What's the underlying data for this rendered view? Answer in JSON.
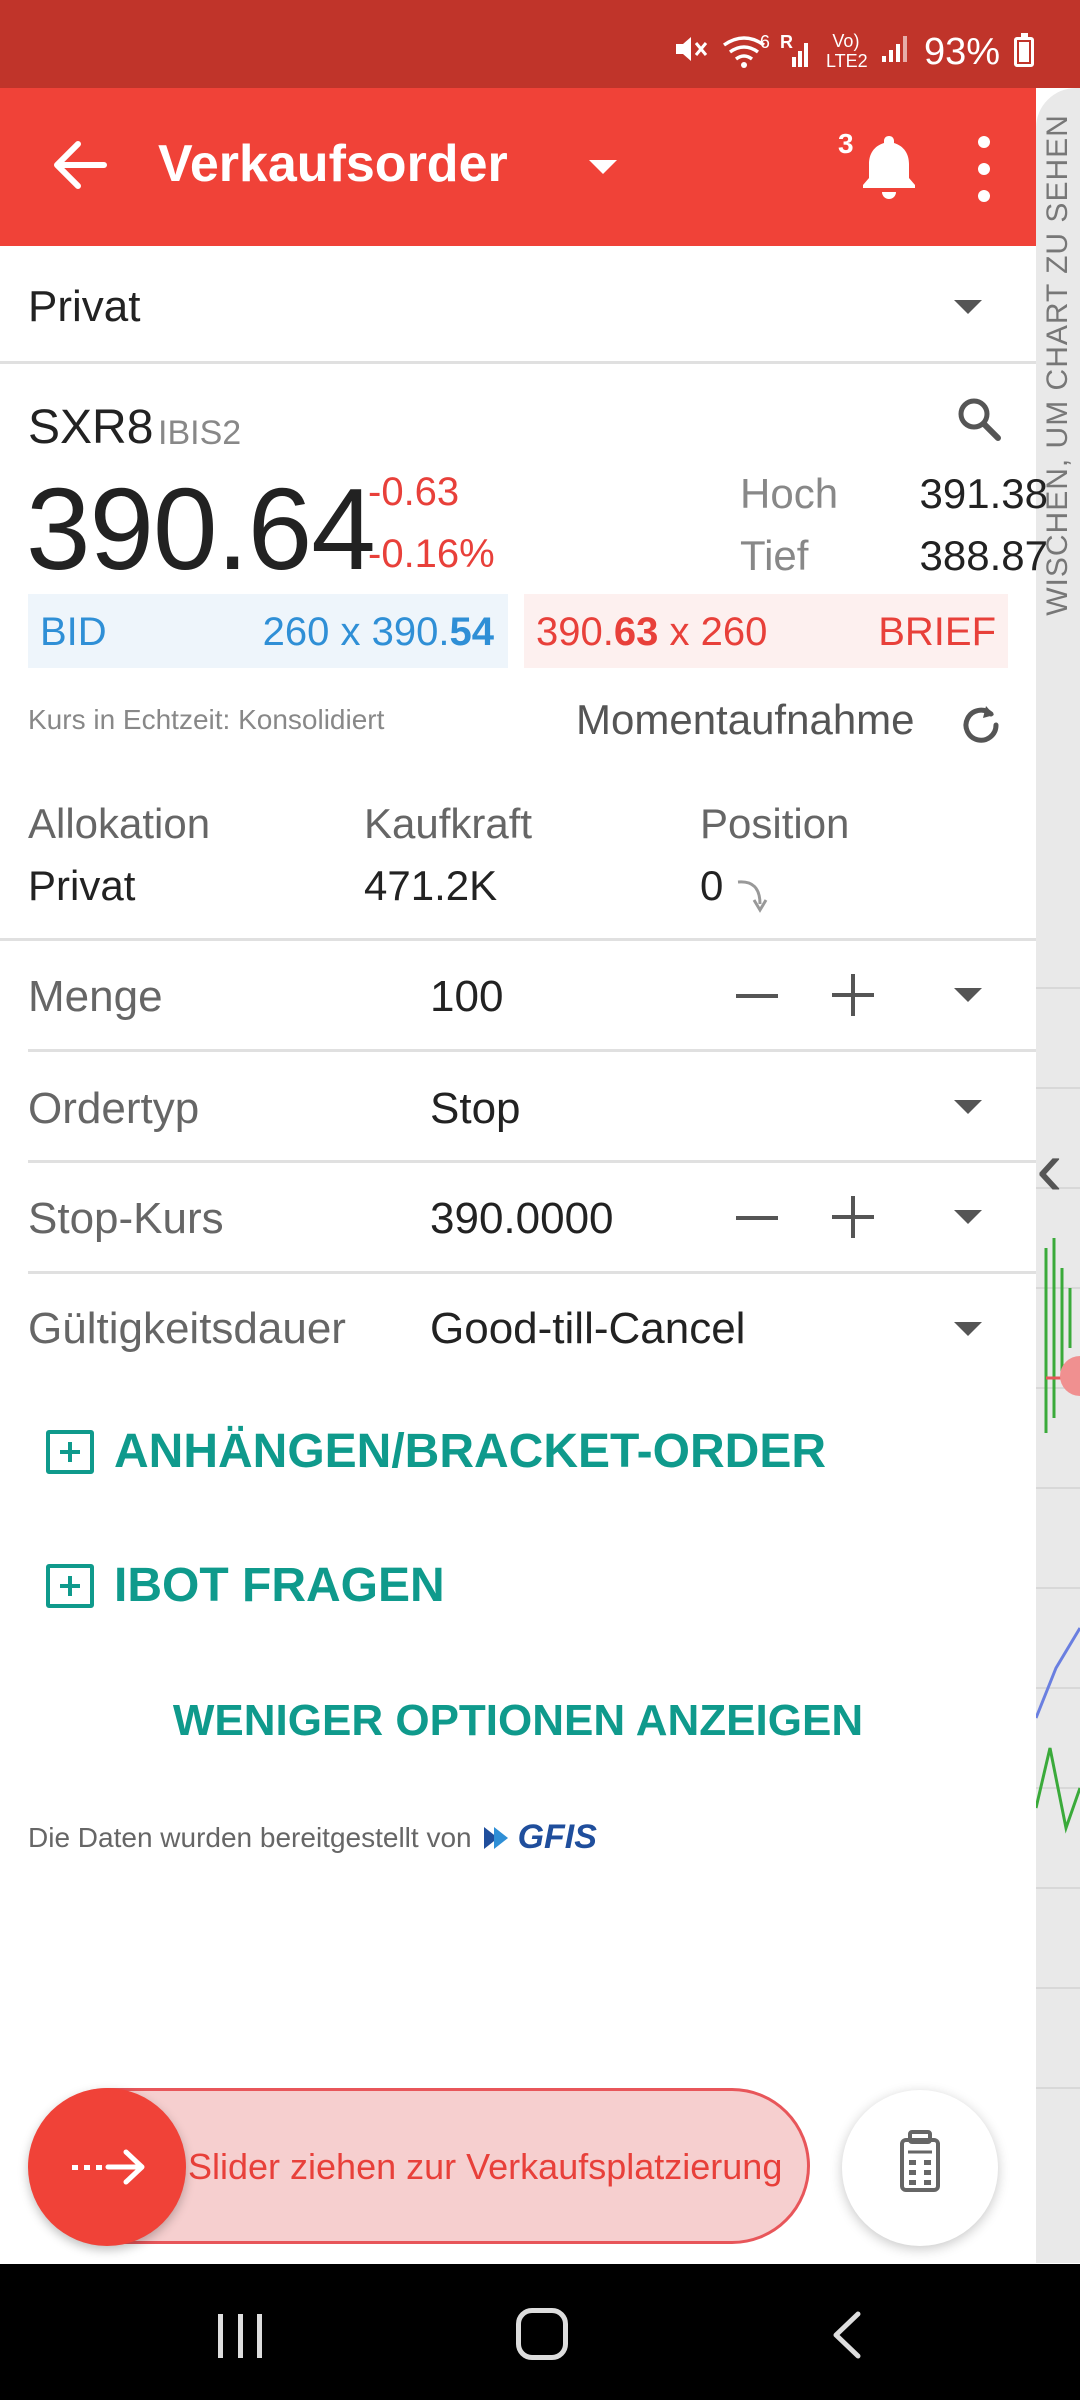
{
  "status_bar": {
    "battery_percent": "93%",
    "signal_small_label": "R",
    "volte_label": "Vo) LTE2",
    "wifi_label": "6"
  },
  "app_bar": {
    "title": "Verkaufsorder",
    "notification_count": "3"
  },
  "account_selector": {
    "label": "Privat"
  },
  "side_panel": {
    "hint": "WISCHEN, UM CHART ZU SEHEN"
  },
  "quote": {
    "symbol": "SXR8",
    "exchange": "IBIS2",
    "last_price": "390.64",
    "change": "-0.63",
    "change_pct": "-0.16%",
    "high_label": "Hoch",
    "high_value": "391.38",
    "low_label": "Tief",
    "low_value": "388.87",
    "bid_label": "BID",
    "bid_size": "260",
    "bid_price_prefix": "390.",
    "bid_price_bold": "54",
    "ask_price_prefix": "390.",
    "ask_price_bold": "63",
    "ask_size": "260",
    "ask_label": "BRIEF",
    "size_separator": "x",
    "realtime_note": "Kurs in Echtzeit: Konsolidiert",
    "snapshot_label": "Momentaufnahme"
  },
  "account_info": {
    "allocation_label": "Allokation",
    "allocation_value": "Privat",
    "buying_power_label": "Kaufkraft",
    "buying_power_value": "471.2K",
    "position_label": "Position",
    "position_value": "0"
  },
  "order_form": {
    "quantity_label": "Menge",
    "quantity_value": "100",
    "order_type_label": "Ordertyp",
    "order_type_value": "Stop",
    "stop_price_label": "Stop-Kurs",
    "stop_price_value": "390.0000",
    "tif_label": "Gültigkeitsdauer",
    "tif_value": "Good-till-Cancel"
  },
  "actions": {
    "attach_bracket": "ANHÄNGEN/BRACKET-ORDER",
    "ask_ibot": "IBOT FRAGEN",
    "fewer_options": "WENIGER OPTIONEN ANZEIGEN"
  },
  "credit": {
    "text": "Die Daten wurden bereitgestellt von",
    "provider": "GFIS"
  },
  "slider": {
    "label": "Slider ziehen zur Verkaufsplatzierung"
  },
  "colors": {
    "brand_red": "#f04238",
    "status_red": "#c0342a",
    "teal": "#0f9a8c",
    "bid_blue": "#2f8fd6",
    "negative_red": "#e8403a"
  },
  "icons": {
    "back": "arrow-left-icon",
    "title_dropdown": "caret-down-icon",
    "notifications": "bell-icon",
    "overflow": "more-vert-icon",
    "search": "search-icon",
    "refresh": "refresh-icon",
    "calculator": "calculator-icon",
    "slider_knob": "dashed-arrow-right-icon"
  }
}
